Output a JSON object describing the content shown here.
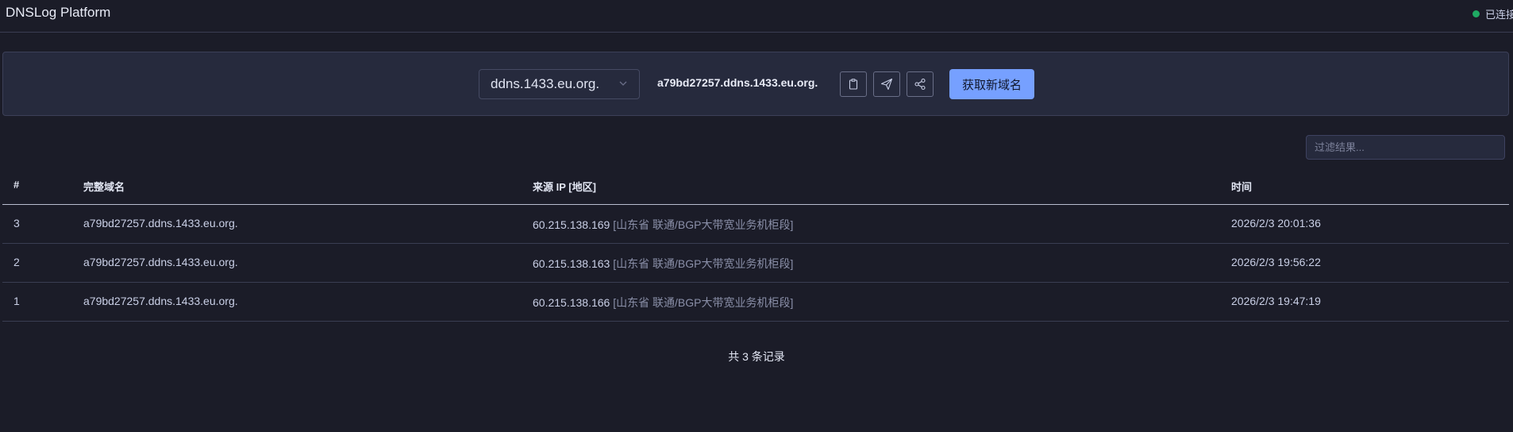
{
  "header": {
    "title": "DNSLog Platform",
    "status": "已连接",
    "status_color": "#1faa63"
  },
  "domain_panel": {
    "selected_domain": "ddns.1433.eu.org.",
    "current_domain": "a79bd27257.ddns.1433.eu.org.",
    "icons": [
      "clipboard-icon",
      "send-icon",
      "share-icon"
    ],
    "new_domain_label": "获取新域名",
    "accent_color": "#76a0ff"
  },
  "filter": {
    "placeholder": "过滤结果..."
  },
  "table": {
    "columns": [
      "#",
      "完整域名",
      "来源 IP [地区]",
      "时间"
    ],
    "rows": [
      {
        "id": "3",
        "domain": "a79bd27257.ddns.1433.eu.org.",
        "ip": "60.215.138.169",
        "region": "[山东省 联通/BGP大带宽业务机柜段]",
        "time": "2026/2/3 20:01:36"
      },
      {
        "id": "2",
        "domain": "a79bd27257.ddns.1433.eu.org.",
        "ip": "60.215.138.163",
        "region": "[山东省 联通/BGP大带宽业务机柜段]",
        "time": "2026/2/3 19:56:22"
      },
      {
        "id": "1",
        "domain": "a79bd27257.ddns.1433.eu.org.",
        "ip": "60.215.138.166",
        "region": "[山东省 联通/BGP大带宽业务机柜段]",
        "time": "2026/2/3 19:47:19"
      }
    ]
  },
  "footer": {
    "count_text": "共 3 条记录"
  }
}
